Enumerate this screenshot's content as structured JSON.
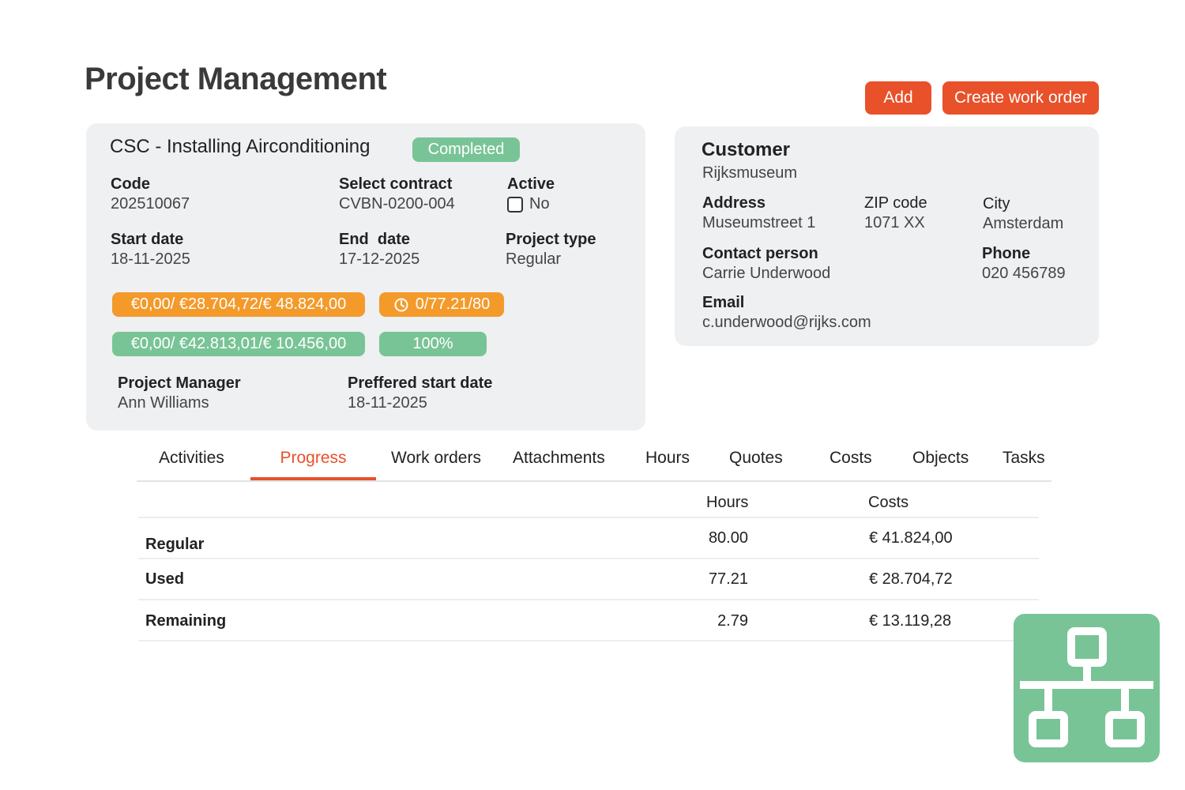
{
  "page": {
    "title": "Project Management"
  },
  "actions": {
    "add_label": "Add",
    "create_work_order_label": "Create work order"
  },
  "project": {
    "name": "CSC - Installing Airconditioning",
    "status": "Completed",
    "code_label": "Code",
    "code": "202510067",
    "contract_label": "Select contract",
    "contract": "CVBN-0200-004",
    "active_label": "Active",
    "active_value": "No",
    "start_label": "Start date",
    "start": "18-11-2025",
    "end_label": "End  date",
    "end": "17-12-2025",
    "type_label": "Project type",
    "type": "Regular",
    "budget_cost": "€0,00/ €28.704,72/€ 48.824,00",
    "budget_hours": "0/77.21/80",
    "revenue": "€0,00/ €42.813,01/€ 10.456,00",
    "progress": "100%",
    "manager_label": "Project Manager",
    "manager": "Ann Williams",
    "pref_start_label": "Preffered start date",
    "pref_start": "18-11-2025"
  },
  "customer": {
    "title": "Customer",
    "name": "Rijksmuseum",
    "address_label": "Address",
    "address": "Museumstreet 1",
    "zip_label": "ZIP code",
    "zip": "1071 XX",
    "city_label": "City",
    "city": "Amsterdam",
    "contact_label": "Contact person",
    "contact": "Carrie Underwood",
    "phone_label": "Phone",
    "phone": "020 456789",
    "email_label": "Email",
    "email": "c.underwood@rijks.com"
  },
  "tabs": [
    "Activities",
    "Progress",
    "Work orders",
    "Attachments",
    "Hours",
    "Quotes",
    "Costs",
    "Objects",
    "Tasks"
  ],
  "active_tab": "Progress",
  "progress_table": {
    "headers": {
      "hours": "Hours",
      "costs": "Costs"
    },
    "rows": [
      {
        "label": "Regular",
        "hours": "80.00",
        "costs": "€ 41.824,00"
      },
      {
        "label": "Used",
        "hours": "77.21",
        "costs": "€ 28.704,72"
      },
      {
        "label": "Remaining",
        "hours": "2.79",
        "costs": "€ 13.119,28"
      }
    ]
  },
  "icons": {
    "hours_pill": "clock-refresh-icon",
    "tile": "network-hierarchy-icon"
  },
  "colors": {
    "accent": "#e8512a",
    "warning": "#f39a2b",
    "success": "#79c496",
    "card_bg": "#eef0f2"
  }
}
